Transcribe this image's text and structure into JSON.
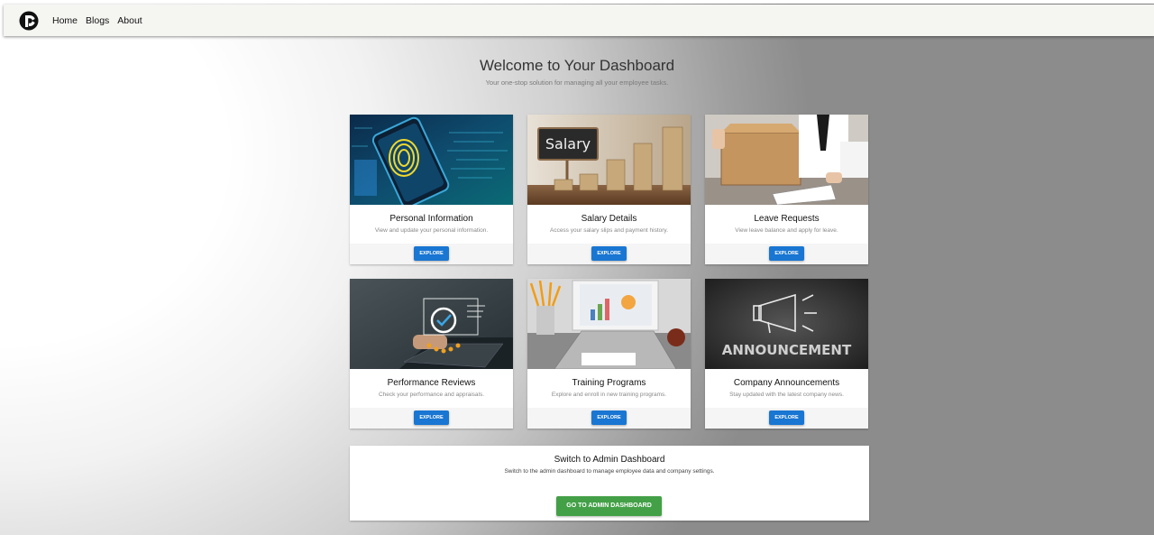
{
  "nav": {
    "logo_icon": "brand-logo",
    "links": [
      "Home",
      "Blogs",
      "About"
    ]
  },
  "hero": {
    "title": "Welcome to Your Dashboard",
    "subtitle": "Your one-stop solution for managing all your employee tasks."
  },
  "cards": [
    {
      "title": "Personal Information",
      "description": "View and update your personal information.",
      "button": "EXPLORE",
      "image": "fingerprint-phone-image"
    },
    {
      "title": "Salary Details",
      "description": "Access your salary slips and payment history.",
      "button": "EXPLORE",
      "image": "salary-coins-image",
      "image_text": "Salary"
    },
    {
      "title": "Leave Requests",
      "description": "View leave balance and apply for leave.",
      "button": "EXPLORE",
      "image": "leave-box-image"
    },
    {
      "title": "Performance Reviews",
      "description": "Check your performance and appraisals.",
      "button": "EXPLORE",
      "image": "performance-laptop-image"
    },
    {
      "title": "Training Programs",
      "description": "Explore and enroll in new training programs.",
      "button": "EXPLORE",
      "image": "training-desk-image"
    },
    {
      "title": "Company Announcements",
      "description": "Stay updated with the latest company news.",
      "button": "EXPLORE",
      "image": "announcement-megaphone-image",
      "image_text": "ANNOUNCEMENT"
    }
  ],
  "admin": {
    "title": "Switch to Admin Dashboard",
    "description": "Switch to the admin dashboard to manage employee data and company settings.",
    "button": "GO TO ADMIN DASHBOARD"
  },
  "colors": {
    "explore_button": "#1976d2",
    "admin_button": "#43a047",
    "navbar": "#f5f5f2"
  }
}
